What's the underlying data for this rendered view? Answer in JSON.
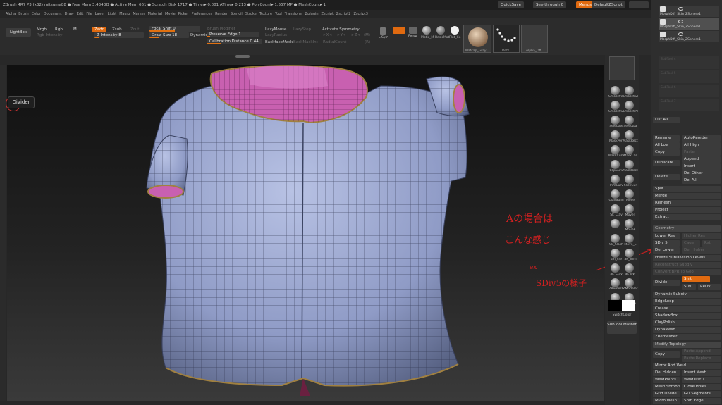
{
  "title_bar": {
    "text": "ZBrush 4R7 P3 (x32)   mitsuma88   ● Free Mem 3.434GB ● Active Mem 661 ● Scratch Disk 1717 ● Timer▸ 0.081 ATime▸ 0.213 ● PolyCount▸ 1.557 MP ● MeshCount▸ 1",
    "quicksave": "QuickSave",
    "see_through": "See-through  0",
    "menus": "Menus",
    "default_zscript": "DefaultZScript"
  },
  "menu_bar": [
    "Alpha",
    "Brush",
    "Color",
    "Document",
    "Draw",
    "Edit",
    "File",
    "Layer",
    "Light",
    "Macro",
    "Marker",
    "Material",
    "Movie",
    "Picker",
    "Preferences",
    "Render",
    "Stencil",
    "Stroke",
    "Texture",
    "Tool",
    "Transform",
    "Zplugin",
    "Zscript",
    "Zscript2",
    "Zscript3"
  ],
  "toolbar": {
    "lightbox": "LightBox",
    "mrgb": "Mrgb",
    "rgb": "Rgb",
    "m": "M",
    "zadd": "Zadd",
    "zsub": "Zsub",
    "zcut": "Zcut",
    "rgb_intensity": "Rgb Intensity",
    "z_intensity": "Z Intensity 8",
    "focal_shift": "Focal Shift 0",
    "draw_size": "Draw Size 18",
    "dynamic": "Dynamic",
    "brush_modifier": "Brush Modifier",
    "preserve_edge": "Preserve Edge 1",
    "calibration_distance": "Calibration Distance 0.44",
    "lazymouse": "LazyMouse",
    "lazystep": "LazyStep",
    "lazyradius": "LazyRadius",
    "backfacemask": "BackfaceMask",
    "backmaskint": "BackMaskInt",
    "radialcount": "RadialCount",
    "activate_symmetry": "Activate Symmetry",
    "sym_x": ">X<",
    "sym_y": ">Y<",
    "sym_z": ">Z<",
    "sym_m": "(M)",
    "sym_r": "(R)",
    "lsym": "L.Sym",
    "persp": "Persp",
    "brush_thumb": "Matic_M",
    "mat_thumb": "BasicMat",
    "flat_thumb": "Flat_Co",
    "matcap_label": "Matcap_Gray",
    "stroke_label": "Dots",
    "alpha_label": "Alpha_Off"
  },
  "canvas": {
    "divider_tooltip": "Divider"
  },
  "shelf": {
    "items": [
      "SmoothVal",
      "SmoothSt",
      "SmoothStr",
      "SmoothPe",
      "SelectRe",
      "SelectLa",
      "MaskPen",
      "MaskRect",
      "MaskCurv",
      "MaskLas",
      "ClipCurv",
      "MaskRect",
      "TrimCurv",
      "SliceCur",
      "ClayBuild",
      "Move",
      "Sk_Clay",
      "MoveT",
      "",
      "MoveE",
      "Sk_Slash",
      "Move_E",
      "sm_cre",
      "Sk_Trim",
      "Sk_Clay",
      "Sk_BW",
      "ZRemesh",
      "ZModeler",
      "Sk_Art",
      "Sk_Pen"
    ],
    "switch_color": "SwitchColor",
    "subtool_master": "SubTool Master"
  },
  "subtool": {
    "items": [
      "MorphDiff_Skin_ZSphere1",
      "MorphDiff_Skin_ZSphere1",
      "MorphDiff_Skin_ZSphere1"
    ],
    "empty_slots": [
      "SubTool 4",
      "SubTool 5",
      "SubTool 6",
      "SubTool 7"
    ],
    "list_all": "List All",
    "rename": "Rename",
    "autoreorder": "AutoReorder",
    "all_low": "All Low",
    "all_high": "All High",
    "copy": "Copy",
    "paste": "Paste",
    "duplicate": "Duplicate",
    "append": "Append",
    "insert": "Insert",
    "delete": "Delete",
    "del_other": "Del Other",
    "del_all": "Del All",
    "split": "Split",
    "merge": "Merge",
    "remesh": "Remesh",
    "project": "Project",
    "extract": "Extract"
  },
  "geometry": {
    "header": "Geometry",
    "lower_res": "Lower Res",
    "higher_res": "Higher Res",
    "sdiv": "SDiv 5",
    "cage": "Cage",
    "rstr": "Rstr",
    "del_lower": "Del Lower",
    "del_higher": "Del Higher",
    "freeze": "Freeze SubDivision Levels",
    "reconstruct": "Reconstruct Subdiv",
    "convert_bpr": "Convert BPR To Geo",
    "divide": "Divide",
    "smt": "Smt",
    "suv": "Suv",
    "reuv": "ReUV",
    "dynamic_subdiv": "Dynamic Subdiv",
    "edgeloop": "EdgeLoop",
    "crease": "Crease",
    "shadowbox": "ShadowBox",
    "claypolish": "ClayPolish",
    "dynamesh": "DynaMesh",
    "zremesher": "ZRemesher",
    "modify_topology": "Modify Topology",
    "copy": "Copy",
    "paste_append": "Paste Append",
    "paste_replace": "Paste Replace",
    "mirror_and_weld": "Mirror And Weld",
    "del_hidden": "Del Hidden",
    "insert_mesh": "Insert Mesh",
    "weldpoints": "WeldPoints",
    "welddist": "WeldDist 1",
    "meshfrombrush": "MeshFromBrush",
    "close_holes": "Close Holes",
    "grid_divide": "Grid Divide",
    "gd_segments": "GD Segments",
    "micro_mesh": "Micro Mesh",
    "spin_edge": "Spin Edge"
  },
  "annotations": {
    "line1": "Aの場合は",
    "line2": "こんな感じ",
    "line3": "ex",
    "line4": "SDiv5の様子"
  },
  "colors": {
    "accent": "#e06a10",
    "annotation_red": "#d02020",
    "shirt_blue": "#8f9bc6",
    "collar_pink": "#c860b0"
  }
}
